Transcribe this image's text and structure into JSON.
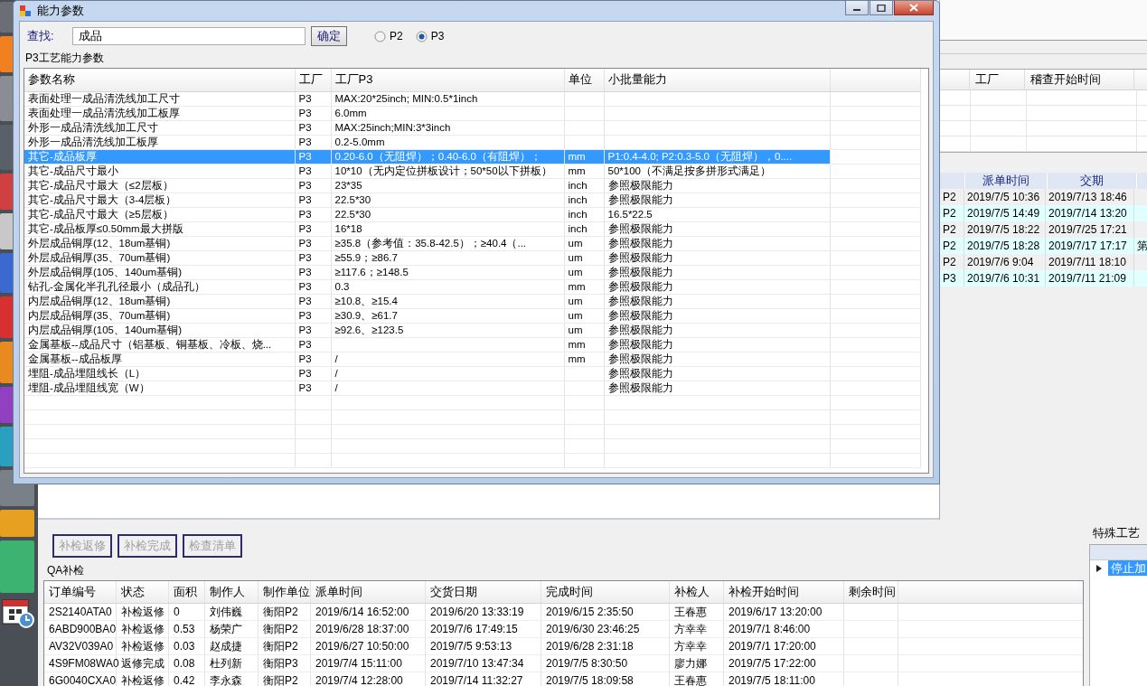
{
  "dialog": {
    "title": "能力参数",
    "search": {
      "label": "查找:",
      "value": "成品"
    },
    "confirm_button": "确定",
    "radios": [
      {
        "label": "P2",
        "selected": false
      },
      {
        "label": "P3",
        "selected": true
      }
    ],
    "group_title": "P3工艺能力参数",
    "table": {
      "columns": [
        "参数名称",
        "工厂",
        "工厂P3",
        "单位",
        "小批量能力"
      ],
      "rows": [
        {
          "name": "表面处理一成品清洗线加工尺寸",
          "factory": "P3",
          "value": "MAX:20*25inch; MIN:0.5*1inch",
          "selected": false
        },
        {
          "name": "表面处理一成品清洗线加工板厚",
          "factory": "P3",
          "value": "6.0mm",
          "selected": false
        },
        {
          "name": "外形一成品清洗线加工尺寸",
          "factory": "P3",
          "value": "MAX:25inch;MIN:3*3inch",
          "selected": false
        },
        {
          "name": "外形一成品清洗线加工板厚",
          "factory": "P3",
          "value": "0.2-5.0mm",
          "selected": false
        },
        {
          "name": "其它-成品板厚",
          "factory": "P3",
          "value": "0.20-6.0（无阻焊）；0.40-6.0（有阻焊）；",
          "unit": "mm",
          "small_batch": "P1:0.4-4.0; P2:0.3-5.0（无阻焊），0....",
          "selected": true
        },
        {
          "name": "其它-成品尺寸最小",
          "factory": "P3",
          "value": "10*10（无内定位拼板设计；50*50以下拼板）",
          "unit": "mm",
          "small_batch": "50*100（不满足按多拼形式满足）",
          "selected": false
        },
        {
          "name": "其它-成品尺寸最大（≤2层板）",
          "factory": "P3",
          "value": "23*35",
          "unit": "inch",
          "small_batch": "参照极限能力",
          "selected": false
        },
        {
          "name": "其它-成品尺寸最大（3-4层板）",
          "factory": "P3",
          "value": "22.5*30",
          "unit": "inch",
          "small_batch": "参照极限能力",
          "selected": false
        },
        {
          "name": "其它-成品尺寸最大（≥5层板）",
          "factory": "P3",
          "value": "22.5*30",
          "unit": "inch",
          "small_batch": "16.5*22.5",
          "selected": false
        },
        {
          "name": "其它-成品板厚≤0.50mm最大拼版",
          "factory": "P3",
          "value": "16*18",
          "unit": "inch",
          "small_batch": "参照极限能力",
          "selected": false
        },
        {
          "name": "外层成品铜厚(12、18um基铜)",
          "factory": "P3",
          "value": "≥35.8（参考值：35.8-42.5）；≥40.4（...",
          "unit": "um",
          "small_batch": "参照极限能力",
          "selected": false
        },
        {
          "name": "外层成品铜厚(35、70um基铜)",
          "factory": "P3",
          "value": "≥55.9；≥86.7",
          "unit": "um",
          "small_batch": "参照极限能力",
          "selected": false
        },
        {
          "name": "外层成品铜厚(105、140um基铜)",
          "factory": "P3",
          "value": "≥117.6；≥148.5",
          "unit": "um",
          "small_batch": "参照极限能力",
          "selected": false
        },
        {
          "name": "钻孔-金属化半孔孔径最小（成品孔）",
          "factory": "P3",
          "value": "0.3",
          "unit": "mm",
          "small_batch": "参照极限能力",
          "selected": false
        },
        {
          "name": "内层成品铜厚(12、18um基铜)",
          "factory": "P3",
          "value": "≥10.8、≥15.4",
          "unit": "um",
          "small_batch": "参照极限能力",
          "selected": false
        },
        {
          "name": "内层成品铜厚(35、70um基铜)",
          "factory": "P3",
          "value": "≥30.9、≥61.7",
          "unit": "um",
          "small_batch": "参照极限能力",
          "selected": false
        },
        {
          "name": "内层成品铜厚(105、140um基铜)",
          "factory": "P3",
          "value": "≥92.6、≥123.5",
          "unit": "um",
          "small_batch": "参照极限能力",
          "selected": false
        },
        {
          "name": "金属基板--成品尺寸（铝基板、铜基板、冷板、烧...",
          "factory": "P3",
          "unit": "mm",
          "small_batch": "参照极限能力",
          "selected": false
        },
        {
          "name": "金属基板--成品板厚",
          "factory": "P3",
          "value": "/",
          "unit": "mm",
          "small_batch": "参照极限能力",
          "selected": false
        },
        {
          "name": "埋阻-成品埋阻线长（L）",
          "factory": "P3",
          "value": "/",
          "small_batch": "参照极限能力",
          "selected": false
        },
        {
          "name": "埋阻-成品埋阻线宽（W）",
          "factory": "P3",
          "value": "/",
          "small_batch": "参照极限能力",
          "selected": false
        }
      ]
    }
  },
  "audit_table": {
    "columns": [
      "工厂",
      "稽查开始时间"
    ]
  },
  "dispatch_table": {
    "columns": [
      "派单时间",
      "交期"
    ],
    "rows": [
      {
        "factory": "P2",
        "dispatch_time": "2019/7/5 10:36",
        "due": "2019/7/13 18:46"
      },
      {
        "factory": "P2",
        "dispatch_time": "2019/7/5 14:49",
        "due": "2019/7/14 13:20"
      },
      {
        "factory": "P2",
        "dispatch_time": "2019/7/5 18:22",
        "due": "2019/7/25 17:21"
      },
      {
        "factory": "P2",
        "dispatch_time": "2019/7/5 18:28",
        "due": "2019/7/17 17:17",
        "column_4": "第"
      },
      {
        "factory": "P2",
        "dispatch_time": "2019/7/6 9:04",
        "due": "2019/7/11 18:10"
      },
      {
        "factory": "P3",
        "dispatch_time": "2019/7/6 10:31",
        "due": "2019/7/11 21:09"
      }
    ]
  },
  "qa": {
    "buttons": [
      {
        "label": "补检返修",
        "disabled": true
      },
      {
        "label": "补检完成",
        "disabled": true
      },
      {
        "label": "检查清单",
        "disabled": true
      }
    ],
    "group_title": "QA补检",
    "table": {
      "columns": [
        "订单编号",
        "状态",
        "面积",
        "制作人",
        "制作单位",
        "派单时间",
        "交货日期",
        "完成时间",
        "补检人",
        "补检开始时间",
        "剩余时间"
      ],
      "rows": [
        {
          "order_no": "2S2140ATA0",
          "status": "补检返修",
          "area": "0",
          "maker": "刘伟巍",
          "unit": "衡阳P2",
          "dispatch_time": "2019/6/14 16:52:00",
          "delivery_date": "2019/6/20 13:33:19",
          "complete_time": "2019/6/15 2:35:50",
          "inspector": "王春惠",
          "inspect_start": "2019/6/17 13:20:00"
        },
        {
          "order_no": "6ABD900BA0",
          "status": "补检返修",
          "area": "0.53",
          "maker": "杨荣广",
          "unit": "衡阳P2",
          "dispatch_time": "2019/6/28 18:37:00",
          "delivery_date": "2019/7/6 17:49:15",
          "complete_time": "2019/6/30 23:46:25",
          "inspector": "方幸幸",
          "inspect_start": "2019/7/1 8:46:00"
        },
        {
          "order_no": "AV32V039A0",
          "status": "补检返修",
          "area": "0.03",
          "maker": "赵成捷",
          "unit": "衡阳P2",
          "dispatch_time": "2019/6/27 10:50:00",
          "delivery_date": "2019/7/5 9:53:13",
          "complete_time": "2019/6/28 2:31:18",
          "inspector": "方幸幸",
          "inspect_start": "2019/7/1 17:20:00"
        },
        {
          "order_no": "4S9FM08WA0",
          "status": "返修完成",
          "area": "0.08",
          "maker": "杜列新",
          "unit": "衡阳P3",
          "dispatch_time": "2019/7/4 15:11:00",
          "delivery_date": "2019/7/10 13:47:34",
          "complete_time": "2019/7/5 8:30:50",
          "inspector": "廖力娜",
          "inspect_start": "2019/7/5 17:22:00"
        },
        {
          "order_no": "6G0040CXA0",
          "status": "补检返修",
          "area": "0.42",
          "maker": "李永森",
          "unit": "衡阳P2",
          "dispatch_time": "2019/7/4 12:28:00",
          "delivery_date": "2019/7/14 11:32:27",
          "complete_time": "2019/7/5 18:09:58",
          "inspector": "王春惠",
          "inspect_start": "2019/7/5 18:11:00"
        }
      ]
    }
  },
  "special_process": {
    "title": "特殊工艺",
    "rows": [
      {
        "text": "停止加",
        "selected": true
      }
    ]
  }
}
